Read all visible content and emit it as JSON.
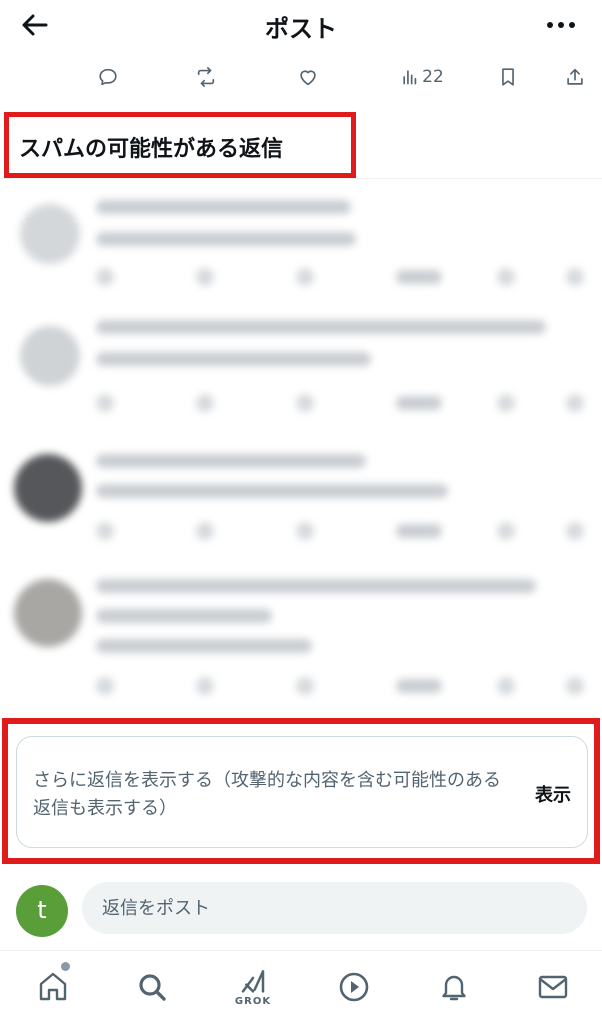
{
  "header": {
    "title": "ポスト"
  },
  "actions": {
    "views_count": "22"
  },
  "spam_section": {
    "title": "スパムの可能性がある返信"
  },
  "show_more": {
    "text": "さらに返信を表示する（攻撃的な内容を含む可能性のある返信も表示する）",
    "button_label": "表示"
  },
  "compose": {
    "avatar_letter": "t",
    "placeholder": "返信をポスト"
  },
  "nav": {
    "grok_label": "GROK"
  },
  "colors": {
    "highlight": "#e01b1b",
    "avatar_green": "#5a9e3a",
    "icon_gray": "#536471"
  }
}
